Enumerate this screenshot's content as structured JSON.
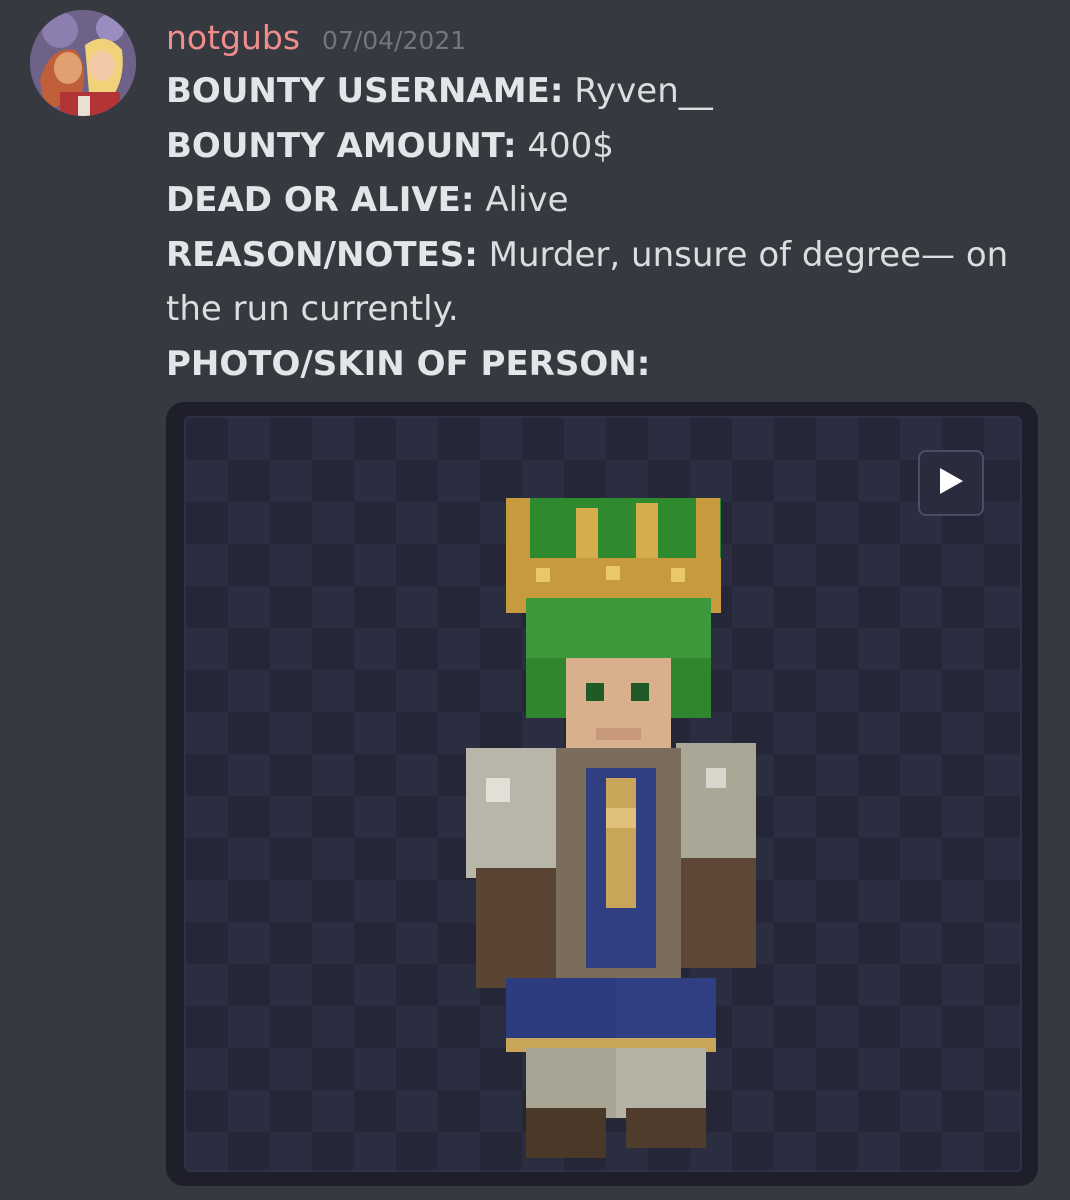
{
  "message": {
    "author": "notgubs",
    "timestamp": "07/04/2021",
    "fields": [
      {
        "label": "BOUNTY USERNAME:",
        "value": "Ryven__"
      },
      {
        "label": "BOUNTY AMOUNT:",
        "value": "400$"
      },
      {
        "label": "DEAD OR ALIVE:",
        "value": "Alive"
      },
      {
        "label": "REASON/NOTES:",
        "value": "Murder, unsure of degree— on the run currently."
      },
      {
        "label": "PHOTO/SKIN OF PERSON:",
        "value": ""
      }
    ]
  },
  "embed": {
    "play_icon": "play-icon"
  },
  "colors": {
    "background": "#36393f",
    "username": "#f08d8d",
    "timestamp": "#72767d",
    "text": "#dcddde",
    "embed_bg": "#1e1f2a"
  }
}
